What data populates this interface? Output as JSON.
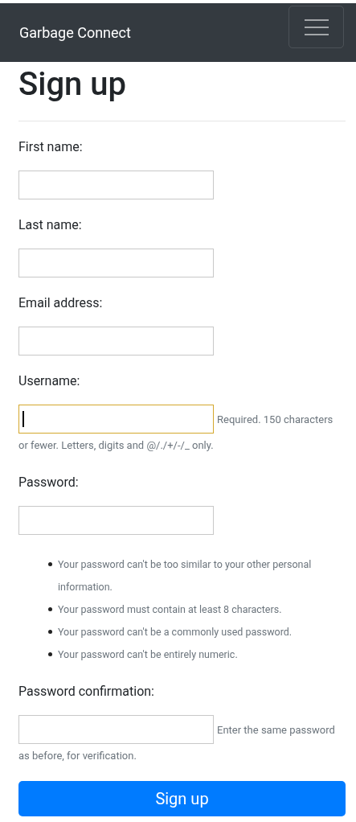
{
  "navbar": {
    "brand": "Garbage Connect"
  },
  "title": "Sign up",
  "fields": [
    {
      "label": "First name:",
      "focused": false
    },
    {
      "label": "Last name:",
      "focused": false
    },
    {
      "label": "Email address:",
      "focused": false
    },
    {
      "label": "Username:",
      "focused": true,
      "help": [
        "Required. 150 characters",
        "or fewer. Letters, digits and @/./+/-/_ only."
      ]
    },
    {
      "label": "Password:",
      "focused": false,
      "requirements": [
        "Your password can't be too similar to your other personal information.",
        "Your password must contain at least 8 characters.",
        "Your password can't be a commonly used password.",
        "Your password can't be entirely numeric."
      ]
    },
    {
      "label": "Password confirmation:",
      "focused": false,
      "help": [
        "Enter the same password",
        "as before, for verification."
      ]
    }
  ],
  "submit": "Sign up"
}
